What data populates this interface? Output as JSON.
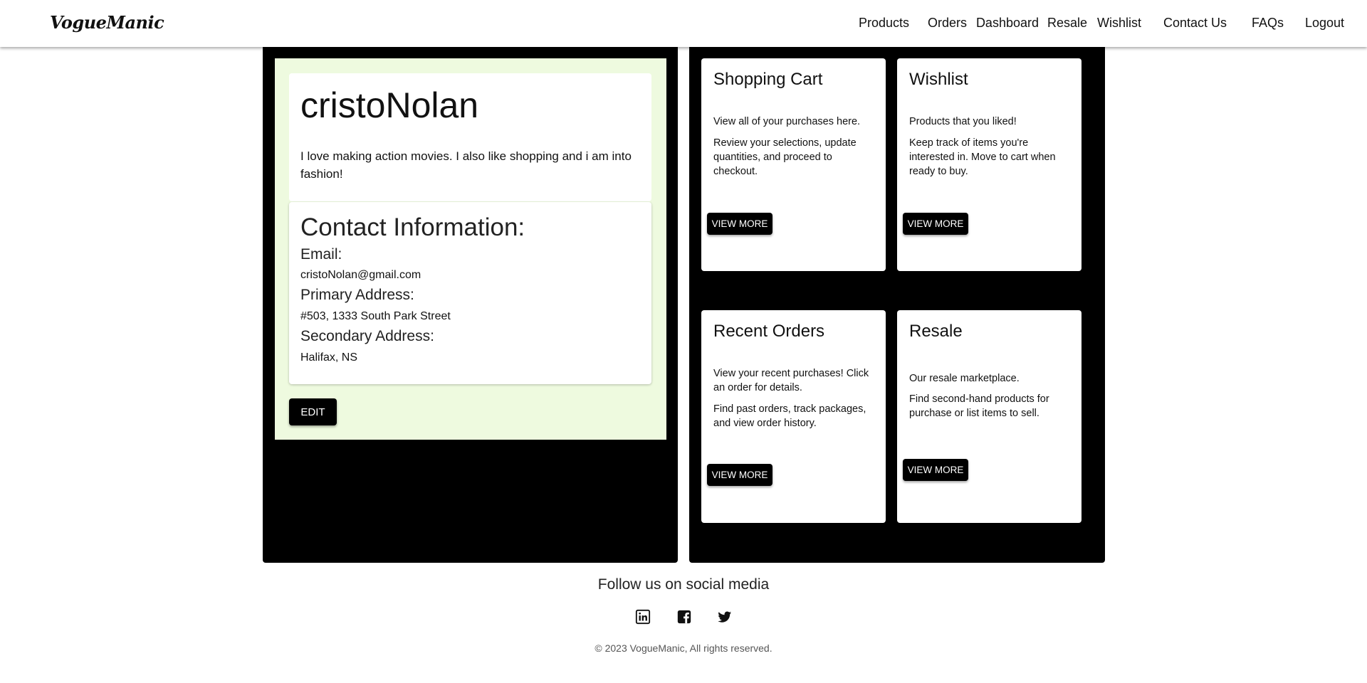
{
  "brand": {
    "name": "VogueManic"
  },
  "nav": {
    "items": [
      "Products",
      "Orders",
      "Dashboard",
      "Resale",
      "Wishlist",
      "Contact Us",
      "FAQs",
      "Logout"
    ]
  },
  "profile": {
    "username": "cristoNolan",
    "bio": "I love making action movies. I also like shopping and i am into fashion!",
    "contact_title": "Contact Information:",
    "email_label": "Email:",
    "email": "cristoNolan@gmail.com",
    "primary_address_label": "Primary Address:",
    "primary_address": "#503, 1333 South Park Street",
    "secondary_address_label": "Secondary Address:",
    "secondary_address": "Halifax, NS",
    "edit_label": "EDIT"
  },
  "features": [
    {
      "title": "Shopping Cart",
      "line1": "View all of your purchases here.",
      "line2": "Review your selections, update quantities, and proceed to checkout.",
      "button": "VIEW MORE"
    },
    {
      "title": "Wishlist",
      "line1": "Products that you liked!",
      "line2": "Keep track of items you're interested in. Move to cart when ready to buy.",
      "button": "VIEW MORE"
    },
    {
      "title": "Recent Orders",
      "line1": "View your recent purchases! Click an order for details.",
      "line2": "Find past orders, track packages, and view order history.",
      "button": "VIEW MORE"
    },
    {
      "title": "Resale",
      "line1": "Our resale marketplace.",
      "line2": "Find second-hand products for purchase or list items to sell.",
      "button": "VIEW MORE"
    }
  ],
  "footer": {
    "follow": "Follow us on social media",
    "social_icons": [
      "linkedin-icon",
      "facebook-icon",
      "twitter-icon"
    ],
    "copyright": "© 2023 VogueManic, All rights reserved."
  },
  "colors": {
    "panel_bg": "#000000",
    "profile_bg": "#eefadf",
    "button_bg": "#000000"
  }
}
